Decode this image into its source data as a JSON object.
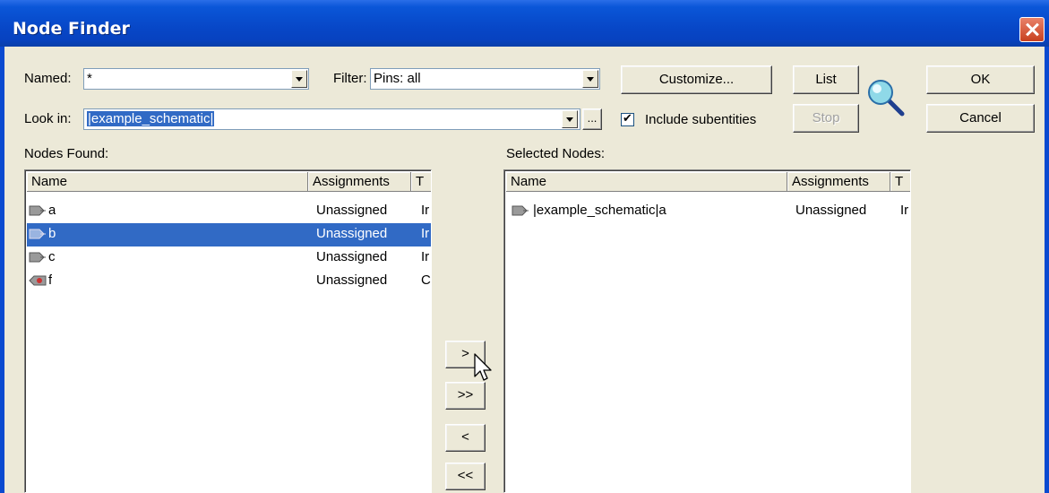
{
  "window": {
    "title": "Node Finder"
  },
  "named": {
    "label": "Named:",
    "value": "*"
  },
  "filter": {
    "label": "Filter:",
    "value": "Pins: all"
  },
  "look_in": {
    "label": "Look in:",
    "value": "|example_schematic|",
    "browse": "..."
  },
  "include_subentities": {
    "label": "Include subentities",
    "checked": true
  },
  "buttons": {
    "customize": "Customize...",
    "list": "List",
    "stop": "Stop",
    "ok": "OK",
    "cancel": "Cancel",
    "add": ">",
    "add_all": ">>",
    "remove": "<",
    "remove_all": "<<"
  },
  "nodes_found": {
    "label": "Nodes Found:",
    "columns": [
      "Name",
      "Assignments",
      "T"
    ],
    "rows": [
      {
        "icon": "input-pin-icon",
        "name": "a",
        "assignments": "Unassigned",
        "type": "Ir",
        "selected": false
      },
      {
        "icon": "input-pin-icon",
        "name": "b",
        "assignments": "Unassigned",
        "type": "Ir",
        "selected": true
      },
      {
        "icon": "input-pin-icon",
        "name": "c",
        "assignments": "Unassigned",
        "type": "Ir",
        "selected": false
      },
      {
        "icon": "output-pin-icon",
        "name": "f",
        "assignments": "Unassigned",
        "type": "C",
        "selected": false
      }
    ]
  },
  "selected_nodes": {
    "label": "Selected Nodes:",
    "columns": [
      "Name",
      "Assignments",
      "T"
    ],
    "rows": [
      {
        "icon": "input-pin-icon",
        "name": "|example_schematic|a",
        "assignments": "Unassigned",
        "type": "Ir"
      }
    ]
  }
}
